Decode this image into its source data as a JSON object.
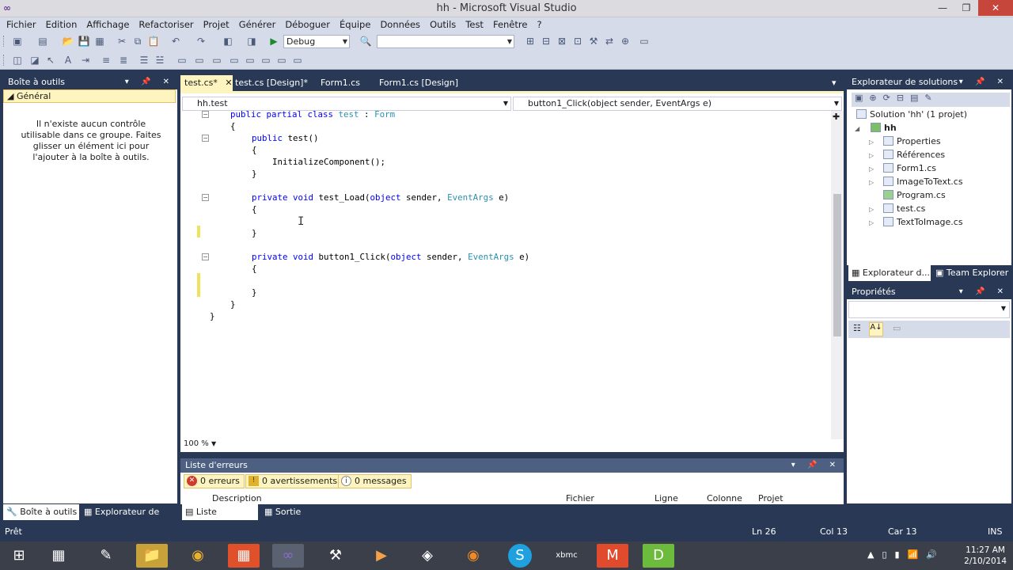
{
  "window": {
    "title": "hh - Microsoft Visual Studio"
  },
  "menu": [
    "Fichier",
    "Edition",
    "Affichage",
    "Refactoriser",
    "Projet",
    "Générer",
    "Déboguer",
    "Équipe",
    "Données",
    "Outils",
    "Test",
    "Fenêtre",
    "?"
  ],
  "toolbar": {
    "config": "Debug",
    "platform": ""
  },
  "toolbox": {
    "title": "Boîte à outils",
    "group": "Général",
    "message": "Il n'existe aucun contrôle utilisable dans ce groupe. Faites glisser un élément ici pour l'ajouter à la boîte à outils.",
    "bottom_tabs": [
      "Boîte à outils",
      "Explorateur de ser..."
    ]
  },
  "editor": {
    "tabs": [
      "test.cs*",
      "test.cs [Design]*",
      "Form1.cs",
      "Form1.cs [Design]"
    ],
    "nav_left": "hh.test",
    "nav_right": "button1_Click(object sender, EventArgs e)",
    "zoom": "100 %"
  },
  "errlist": {
    "title": "Liste d'erreurs",
    "errors": "0 erreurs",
    "warnings": "0 avertissements",
    "messages": "0 messages",
    "columns": [
      "Description",
      "Fichier",
      "Ligne",
      "Colonne",
      "Projet"
    ],
    "bottom_tabs": [
      "Liste d'erreurs",
      "Sortie"
    ]
  },
  "solution": {
    "title": "Explorateur de solutions",
    "root": "Solution 'hh' (1 projet)",
    "project": "hh",
    "items": [
      "Properties",
      "Références",
      "Form1.cs",
      "ImageToText.cs",
      "Program.cs",
      "test.cs",
      "TextToImage.cs"
    ],
    "bottom_tabs": [
      "Explorateur d...",
      "Team Explorer"
    ]
  },
  "properties": {
    "title": "Propriétés"
  },
  "status": {
    "ready": "Prêt",
    "line": "Ln 26",
    "col": "Col 13",
    "char": "Car 13",
    "mode": "INS"
  },
  "clock": {
    "time": "11:27 AM",
    "date": "2/10/2014"
  }
}
